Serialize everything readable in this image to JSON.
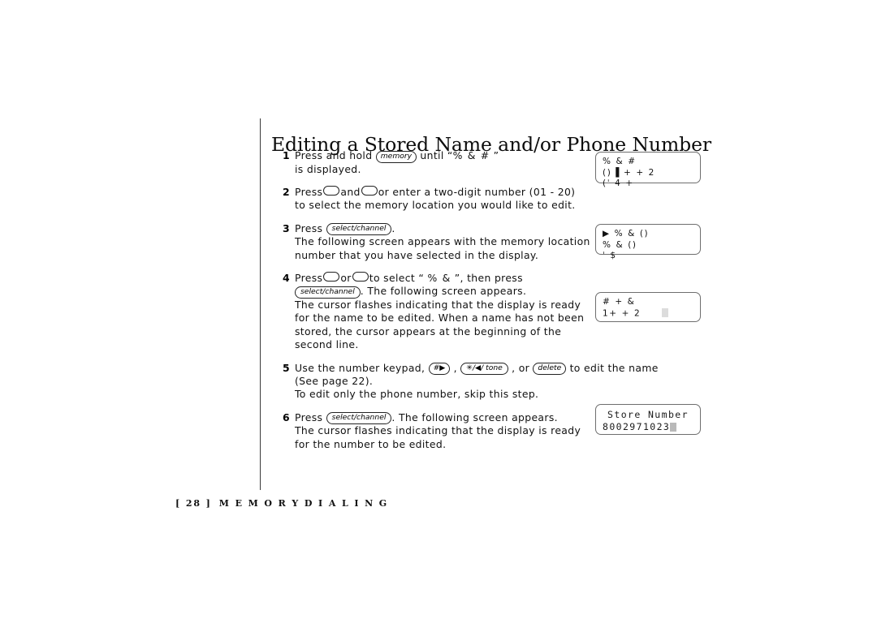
{
  "title": "Editing a Stored Name and/or Phone Number",
  "steps": [
    {
      "number": "1",
      "lines": [
        {
          "parts": [
            {
              "type": "text",
              "text": "Press and hold "
            },
            {
              "type": "key",
              "text": "memory"
            },
            {
              "type": "text",
              "text": " until “"
            },
            {
              "type": "garble",
              "text": "% &   #"
            },
            {
              "type": "text",
              "text": "                 ”"
            }
          ]
        },
        {
          "parts": [
            {
              "type": "text",
              "text": "is displayed."
            }
          ]
        }
      ]
    },
    {
      "number": "2",
      "lines": [
        {
          "parts": [
            {
              "type": "text",
              "text": "Press"
            },
            {
              "type": "oval",
              "text": ""
            },
            {
              "type": "text",
              "text": "and"
            },
            {
              "type": "oval",
              "text": ""
            },
            {
              "type": "text",
              "text": "or enter a two-digit number (01 - 20)"
            }
          ]
        },
        {
          "parts": [
            {
              "type": "text",
              "text": "to select the memory location you would like to edit."
            }
          ]
        }
      ]
    },
    {
      "number": "3",
      "lines": [
        {
          "parts": [
            {
              "type": "text",
              "text": "Press "
            },
            {
              "type": "key",
              "text": "select/channel"
            },
            {
              "type": "text",
              "text": "."
            }
          ]
        },
        {
          "parts": [
            {
              "type": "text",
              "text": "The following screen appears with the memory location"
            }
          ]
        },
        {
          "parts": [
            {
              "type": "text",
              "text": "number that you have selected in the display."
            }
          ]
        }
      ]
    },
    {
      "number": "4",
      "lines": [
        {
          "parts": [
            {
              "type": "text",
              "text": "Press"
            },
            {
              "type": "oval",
              "text": ""
            },
            {
              "type": "text",
              "text": "or"
            },
            {
              "type": "oval",
              "text": ""
            },
            {
              "type": "text",
              "text": "to select “  "
            },
            {
              "type": "garble",
              "text": "% &"
            },
            {
              "type": "text",
              "text": "            ”, then press"
            }
          ]
        },
        {
          "parts": [
            {
              "type": "key",
              "text": "select/channel"
            },
            {
              "type": "text",
              "text": ". The following screen appears."
            }
          ]
        },
        {
          "parts": [
            {
              "type": "text",
              "text": "The cursor flashes indicating that the display is ready"
            }
          ]
        },
        {
          "parts": [
            {
              "type": "text",
              "text": "for the name to be edited. When a name has not been"
            }
          ]
        },
        {
          "parts": [
            {
              "type": "text",
              "text": "stored, the cursor appears at the beginning of the"
            }
          ]
        },
        {
          "parts": [
            {
              "type": "text",
              "text": "second line."
            }
          ]
        }
      ]
    },
    {
      "number": "5",
      "lines": [
        {
          "parts": [
            {
              "type": "text",
              "text": "Use the number keypad, "
            },
            {
              "type": "key",
              "text": "#▶"
            },
            {
              "type": "text",
              "text": " , "
            },
            {
              "type": "key",
              "text": "✳/◀/ tone"
            },
            {
              "type": "text",
              "text": " , or "
            },
            {
              "type": "key",
              "text": "delete"
            },
            {
              "type": "text",
              "text": "  to edit the name"
            }
          ]
        },
        {
          "parts": [
            {
              "type": "text",
              "text": "(See page 22)."
            }
          ]
        },
        {
          "parts": [
            {
              "type": "text",
              "text": "To edit only the phone number, skip this step."
            }
          ]
        }
      ]
    },
    {
      "number": "6",
      "lines": [
        {
          "parts": [
            {
              "type": "text",
              "text": "Press "
            },
            {
              "type": "key",
              "text": "select/channel"
            },
            {
              "type": "text",
              "text": ". The following screen appears."
            }
          ]
        },
        {
          "parts": [
            {
              "type": "text",
              "text": "The cursor flashes indicating that the display is ready"
            }
          ]
        },
        {
          "parts": [
            {
              "type": "text",
              "text": "for the number to be edited."
            }
          ]
        }
      ]
    }
  ],
  "displays": {
    "lcd1": {
      "rows": [
        "  % &   #",
        "()  ▌+  +   2",
        "(ˈ 4  +"
      ]
    },
    "lcd2": {
      "rows": [
        "▶    % &  ()",
        "     % &  ()",
        "ˈ   $"
      ]
    },
    "lcd3": {
      "rows": [
        "  #    + &",
        "1+   +   2"
      ]
    },
    "lcd4": {
      "line1": "Store Number",
      "line2": "8002971023"
    }
  },
  "footer": {
    "page_number": "[ 28 ]",
    "section": "M E M O R Y   D I A L I N G"
  }
}
